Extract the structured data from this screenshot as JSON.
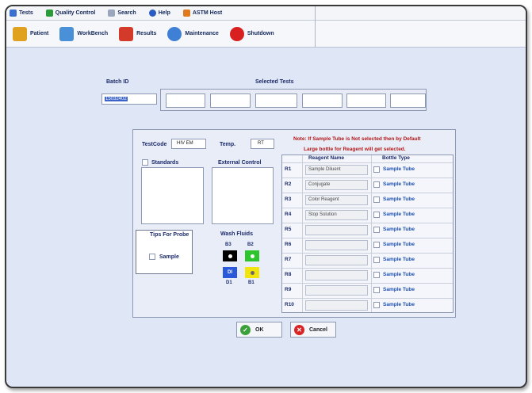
{
  "menu": [
    {
      "label": "Tests",
      "icon": "tests-icon",
      "color": "#3a6fd0"
    },
    {
      "label": "Quality Control",
      "icon": "quality-control-icon",
      "color": "#2c9c3a"
    },
    {
      "label": "Search",
      "icon": "search-icon",
      "color": "#9aa6bd"
    },
    {
      "label": "Help",
      "icon": "help-icon",
      "color": "#2a5bc4"
    },
    {
      "label": "ASTM Host",
      "icon": "astm-host-icon",
      "color": "#e07a1f"
    }
  ],
  "toolbar": [
    {
      "label": "Patient",
      "icon": "patient-icon",
      "color": "#e0a020"
    },
    {
      "label": "WorkBench",
      "icon": "workbench-icon",
      "color": "#4a90d9"
    },
    {
      "label": "Results",
      "icon": "results-icon",
      "color": "#d43a2a"
    },
    {
      "label": "Maintenance",
      "icon": "maintenance-icon",
      "color": "#3f7fd6"
    },
    {
      "label": "Shutdown",
      "icon": "shutdown-icon",
      "color": "#d82020"
    }
  ],
  "batch": {
    "label": "Batch ID",
    "value": "15032402"
  },
  "selected_tests": {
    "label": "Selected Tests",
    "slots": [
      "",
      "",
      "",
      "",
      "",
      ""
    ]
  },
  "test_info": {
    "testcode_label": "TestCode",
    "testcode_value": "HIV EM",
    "temp_label": "Temp.",
    "temp_value": "RT"
  },
  "note": {
    "line1": "Note: If Sample Tube is Not selected then by Default",
    "line2": "Large bottle for Reagent will get selected."
  },
  "standards": {
    "label": "Standards"
  },
  "external_control": {
    "label": "External Control"
  },
  "probe": {
    "title": "Tips For Probe",
    "sample_label": "Sample"
  },
  "wash_fluids": {
    "title": "Wash Fluids",
    "items": [
      {
        "label": "B3",
        "color": "#000000"
      },
      {
        "label": "B2",
        "color": "#2dc42d"
      },
      {
        "label": "DI",
        "color": "#2a5ad9"
      },
      {
        "label": "B1",
        "color": "#f2e40d"
      }
    ],
    "bottom_labels": [
      "D1",
      "B1"
    ]
  },
  "reagents": {
    "headers": {
      "name": "Reagent Name",
      "bottle": "Bottle Type"
    },
    "rows": [
      {
        "id": "R1",
        "name": "Sample Diluent",
        "tube": "Sample Tube"
      },
      {
        "id": "R2",
        "name": "Conjugate",
        "tube": "Sample Tube"
      },
      {
        "id": "R3",
        "name": "Color Reagent",
        "tube": "Sample Tube"
      },
      {
        "id": "R4",
        "name": "Stop Solution",
        "tube": "Sample Tube"
      },
      {
        "id": "R5",
        "name": "",
        "tube": "Sample Tube"
      },
      {
        "id": "R6",
        "name": "",
        "tube": "Sample Tube"
      },
      {
        "id": "R7",
        "name": "",
        "tube": "Sample Tube"
      },
      {
        "id": "R8",
        "name": "",
        "tube": "Sample Tube"
      },
      {
        "id": "R9",
        "name": "",
        "tube": "Sample Tube"
      },
      {
        "id": "R10",
        "name": "",
        "tube": "Sample Tube"
      }
    ]
  },
  "buttons": {
    "ok": "OK",
    "cancel": "Cancel",
    "ok_color": "#3aa03a",
    "cancel_color": "#d82626"
  }
}
